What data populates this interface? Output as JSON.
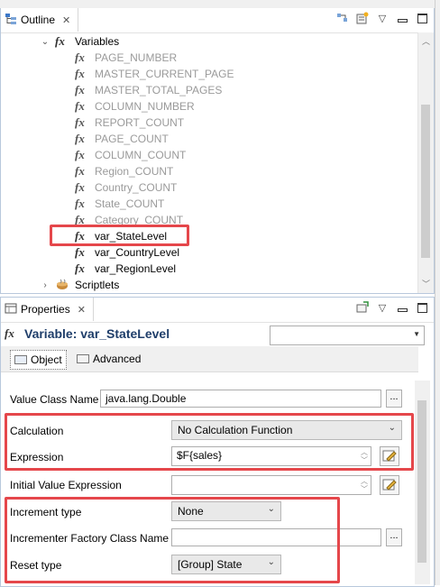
{
  "outline": {
    "tab_title": "Outline",
    "tree": {
      "variables_label": "Variables",
      "items": [
        {
          "label": "PAGE_NUMBER",
          "dim": true
        },
        {
          "label": "MASTER_CURRENT_PAGE",
          "dim": true
        },
        {
          "label": "MASTER_TOTAL_PAGES",
          "dim": true
        },
        {
          "label": "COLUMN_NUMBER",
          "dim": true
        },
        {
          "label": "REPORT_COUNT",
          "dim": true
        },
        {
          "label": "PAGE_COUNT",
          "dim": true
        },
        {
          "label": "COLUMN_COUNT",
          "dim": true
        },
        {
          "label": "Region_COUNT",
          "dim": true
        },
        {
          "label": "Country_COUNT",
          "dim": true
        },
        {
          "label": "State_COUNT",
          "dim": true
        },
        {
          "label": "Category_COUNT",
          "dim": true
        },
        {
          "label": "var_StateLevel",
          "dim": false
        },
        {
          "label": "var_CountryLevel",
          "dim": false
        },
        {
          "label": "var_RegionLevel",
          "dim": false
        }
      ],
      "scriptlets_label": "Scriptlets"
    }
  },
  "properties": {
    "tab_title": "Properties",
    "heading": "Variable: var_StateLevel",
    "tabs": {
      "object": "Object",
      "advanced": "Advanced"
    },
    "fields": {
      "value_class_label": "Value Class Name",
      "value_class_value": "java.lang.Double",
      "calculation_label": "Calculation",
      "calculation_value": "No Calculation Function",
      "expression_label": "Expression",
      "expression_value": "$F{sales}",
      "initial_value_label": "Initial Value Expression",
      "initial_value_value": "",
      "increment_type_label": "Increment type",
      "increment_type_value": "None",
      "incrementer_factory_label": "Incrementer Factory Class Name",
      "incrementer_factory_value": "",
      "reset_type_label": "Reset type",
      "reset_type_value": "[Group] State"
    },
    "dots_label": "..."
  },
  "colors": {
    "highlight": "#e5474b",
    "title": "#1f3e6a"
  },
  "icons": [
    "outline-icon",
    "fx-icon",
    "scriptlets-icon",
    "properties-icon",
    "edit-expression-icon"
  ]
}
